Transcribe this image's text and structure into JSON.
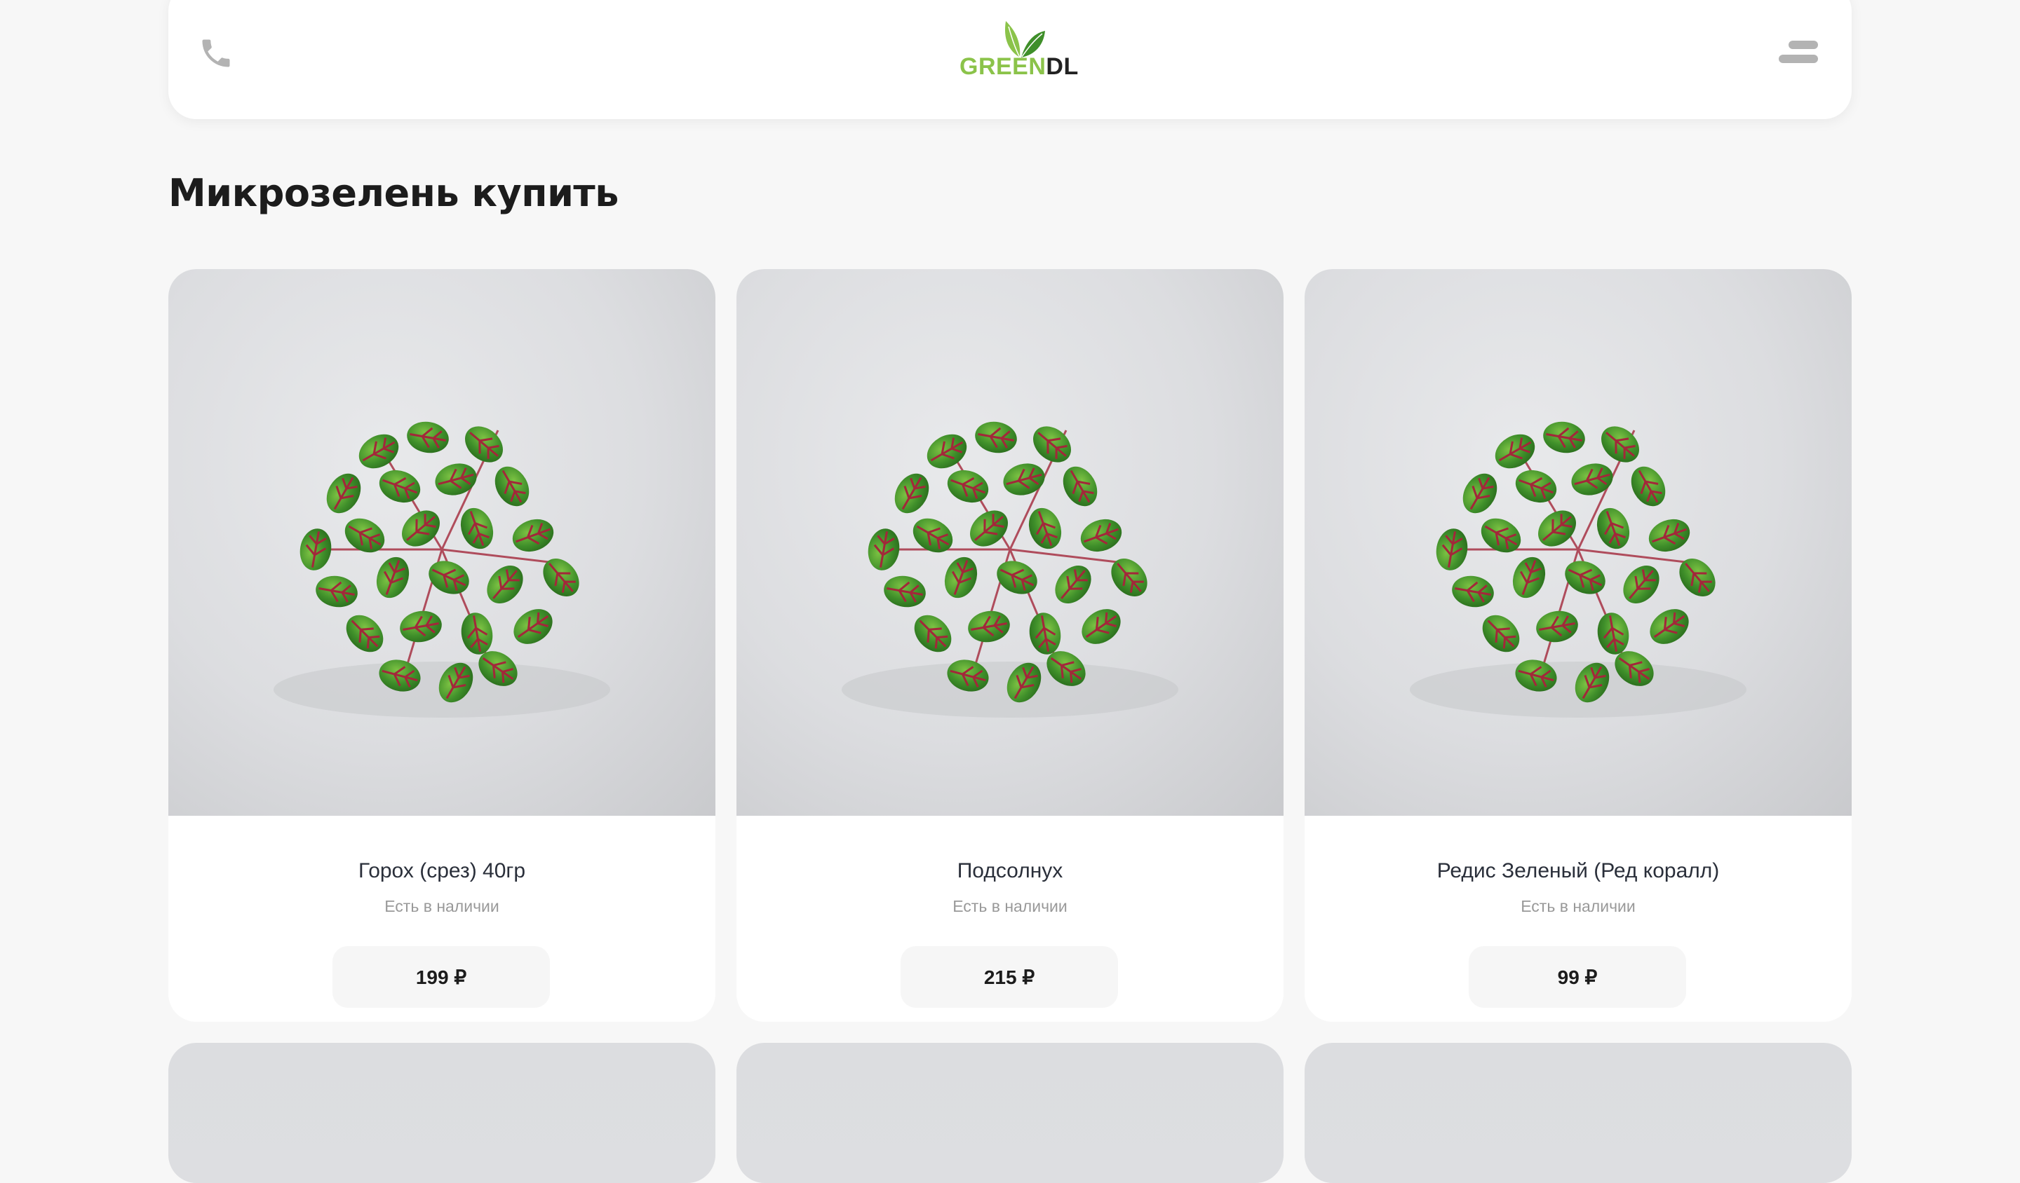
{
  "header": {
    "phone_icon": "phone-icon",
    "logo": {
      "part1": "GREEN",
      "part2": "DL"
    },
    "menu_icon": "hamburger-menu-icon"
  },
  "page_title": "Микрозелень купить",
  "products": [
    {
      "name": "Горох (срез) 40гр",
      "stock": "Есть в наличии",
      "price": "199 ₽"
    },
    {
      "name": "Подсолнух",
      "stock": "Есть в наличии",
      "price": "215 ₽"
    },
    {
      "name": "Редис Зеленый (Ред коралл)",
      "stock": "Есть в наличии",
      "price": "99 ₽"
    }
  ],
  "colors": {
    "background": "#f7f7f7",
    "card": "#ffffff",
    "logo_green": "#8bc34a",
    "leaf_green": "#3f8f2a",
    "vein_red": "#a3273a",
    "muted_text": "#999999"
  }
}
